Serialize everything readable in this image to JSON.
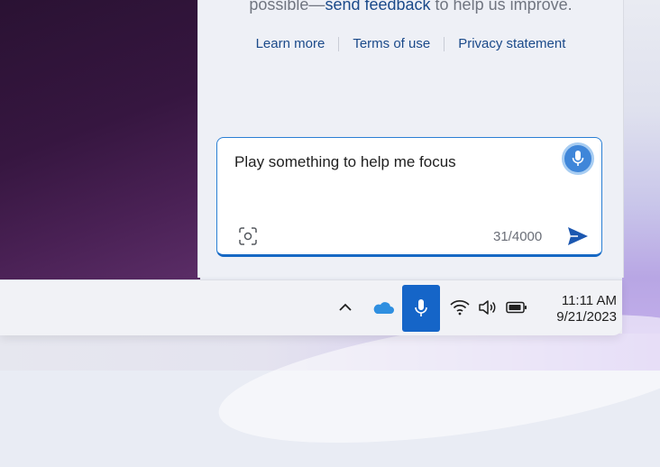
{
  "panel": {
    "disclaimer_prefix": "possible—",
    "disclaimer_link": "send feedback",
    "disclaimer_suffix": " to help us improve.",
    "footer_links": [
      "Learn more",
      "Terms of use",
      "Privacy statement"
    ]
  },
  "prompt": {
    "text": "Play something to help me focus",
    "char_count": "31/4000",
    "mic_icon": "microphone-icon",
    "screenshot_icon": "screenshot-capture-icon",
    "send_icon": "send-icon"
  },
  "taskbar": {
    "tray_icons": [
      "chevron-up-icon",
      "onedrive-cloud-icon",
      "microphone-icon",
      "wifi-icon",
      "volume-icon",
      "battery-icon"
    ],
    "time": "11:11 AM",
    "date": "9/21/2023"
  },
  "colors": {
    "accent": "#1565c8",
    "link": "#1b4a8a",
    "onedrive": "#2f8fe0"
  }
}
